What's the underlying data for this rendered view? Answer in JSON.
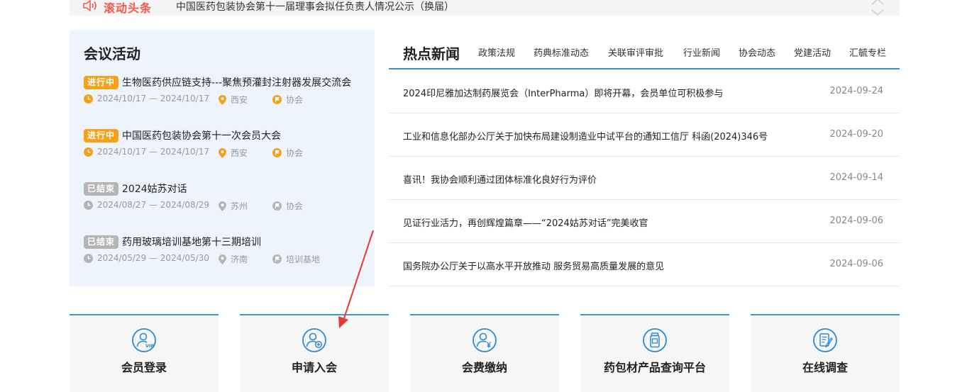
{
  "ticker": {
    "label": "滚动头条",
    "text": "中国医药包装协会第十一届理事会拟任负责人情况公示（换届）"
  },
  "meetings": {
    "title": "会议活动",
    "items": [
      {
        "status": "进行中",
        "state": "ongoing",
        "name": "生物医药供应链支持---聚焦预灌封注射器发展交流会",
        "date": "2024/10/17 — 2024/10/17",
        "city": "西安",
        "organizer": "协会"
      },
      {
        "status": "进行中",
        "state": "ongoing",
        "name": "中国医药包装协会第十一次会员大会",
        "date": "2024/10/17 — 2024/10/17",
        "city": "西安",
        "organizer": "协会"
      },
      {
        "status": "已结束",
        "state": "ended",
        "name": "2024姑苏对话",
        "date": "2024/08/27 — 2024/08/29",
        "city": "苏州",
        "organizer": "协会"
      },
      {
        "status": "已结束",
        "state": "ended",
        "name": "药用玻璃培训基地第十三期培训",
        "date": "2024/05/29 — 2024/05/30",
        "city": "济南",
        "organizer": "培训基地"
      }
    ]
  },
  "news": {
    "title": "热点新闻",
    "tabs": [
      "政策法规",
      "药典标准动态",
      "关联审评审批",
      "行业新闻",
      "协会动态",
      "党建活动",
      "汇毓专栏"
    ],
    "items": [
      {
        "title": "2024印尼雅加达制药展览会（InterPharma）即将开幕，会员单位可积极参与",
        "date": "2024-09-24"
      },
      {
        "title": "工业和信息化部办公厅关于加快布局建设制造业中试平台的通知工信厅 科函(2024)346号",
        "date": "2024-09-20"
      },
      {
        "title": "喜讯！我协会顺利通过团体标准化良好行为评价",
        "date": "2024-09-14"
      },
      {
        "title": "见证行业活力，再创辉煌篇章——“2024姑苏对话”完美收官",
        "date": "2024-09-06"
      },
      {
        "title": "国务院办公厅关于以高水平开放推动 服务贸易高质量发展的意见",
        "date": "2024-09-06"
      }
    ]
  },
  "services": [
    {
      "label": "会员登录",
      "icon": "vip-user-icon"
    },
    {
      "label": "申请入会",
      "icon": "add-user-icon"
    },
    {
      "label": "会费缴纳",
      "icon": "user-payment-icon"
    },
    {
      "label": "药包材产品查询平台",
      "icon": "medicine-bottle-icon"
    },
    {
      "label": "在线调查",
      "icon": "survey-icon"
    }
  ],
  "colors": {
    "accent": "#3a8fd0",
    "ongoing": "#f7a11a",
    "ended": "#b5b5b5",
    "ticker_label": "#f15a4a",
    "annotation": "#e53935"
  }
}
